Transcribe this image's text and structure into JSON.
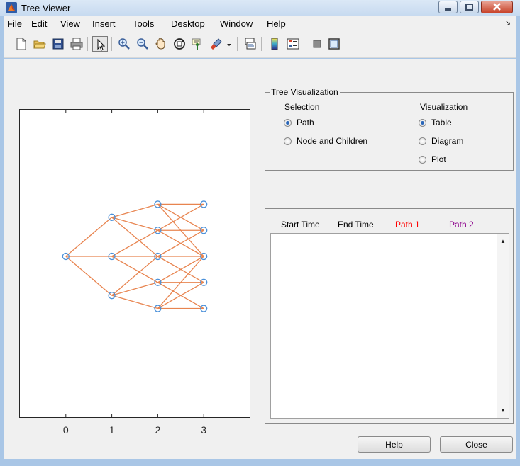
{
  "window": {
    "title": "Tree Viewer"
  },
  "menu": {
    "items": [
      "File",
      "Edit",
      "View",
      "Insert",
      "Tools",
      "Desktop",
      "Window",
      "Help"
    ],
    "dock_arrow": "↘"
  },
  "toolbar": {
    "icons": [
      "new-file-icon",
      "open-folder-icon",
      "save-icon",
      "print-icon",
      "select-pointer-icon",
      "zoom-in-icon",
      "zoom-out-icon",
      "pan-hand-icon",
      "rotate-3d-icon",
      "data-cursor-icon",
      "brush-icon",
      "link-plot-icon",
      "colorbar-icon",
      "legend-icon",
      "hide-plot-tools-icon",
      "show-plot-tools-icon"
    ]
  },
  "colors": {
    "edge": "#e8844f",
    "node": "#4a90d9",
    "path1_label": "#ff0000",
    "path2_label": "#8b008b"
  },
  "chart_data": {
    "type": "scatter",
    "title": "",
    "xlabel": "",
    "ylabel": "",
    "xlim": [
      -1,
      4
    ],
    "x_ticks": [
      "0",
      "1",
      "2",
      "3"
    ],
    "nodes": [
      {
        "x": 0,
        "y": 0
      },
      {
        "x": 1,
        "y": 1.5
      },
      {
        "x": 1,
        "y": 0
      },
      {
        "x": 1,
        "y": -1.5
      },
      {
        "x": 2,
        "y": 2
      },
      {
        "x": 2,
        "y": 1
      },
      {
        "x": 2,
        "y": 0
      },
      {
        "x": 2,
        "y": -1
      },
      {
        "x": 2,
        "y": -2
      },
      {
        "x": 3,
        "y": 2
      },
      {
        "x": 3,
        "y": 1
      },
      {
        "x": 3,
        "y": 0
      },
      {
        "x": 3,
        "y": -1
      },
      {
        "x": 3,
        "y": -2
      }
    ],
    "edges": [
      [
        0,
        1
      ],
      [
        0,
        2
      ],
      [
        0,
        3
      ],
      [
        1,
        4
      ],
      [
        1,
        5
      ],
      [
        1,
        6
      ],
      [
        2,
        5
      ],
      [
        2,
        6
      ],
      [
        2,
        7
      ],
      [
        3,
        6
      ],
      [
        3,
        7
      ],
      [
        3,
        8
      ],
      [
        4,
        9
      ],
      [
        4,
        10
      ],
      [
        4,
        11
      ],
      [
        5,
        9
      ],
      [
        5,
        10
      ],
      [
        5,
        11
      ],
      [
        6,
        10
      ],
      [
        6,
        11
      ],
      [
        6,
        12
      ],
      [
        7,
        11
      ],
      [
        7,
        12
      ],
      [
        7,
        13
      ],
      [
        8,
        11
      ],
      [
        8,
        12
      ],
      [
        8,
        13
      ]
    ]
  },
  "tree_visualization": {
    "title": "Tree Visualization",
    "selection": {
      "heading": "Selection",
      "options": [
        {
          "label": "Path",
          "selected": true
        },
        {
          "label": "Node and Children",
          "selected": false
        }
      ]
    },
    "visualization": {
      "heading": "Visualization",
      "options": [
        {
          "label": "Table",
          "selected": true
        },
        {
          "label": "Diagram",
          "selected": false
        },
        {
          "label": "Plot",
          "selected": false
        }
      ]
    }
  },
  "table": {
    "columns": [
      "Start Time",
      "End Time",
      "Path 1",
      "Path 2"
    ],
    "rows": []
  },
  "buttons": {
    "help": "Help",
    "close": "Close"
  }
}
